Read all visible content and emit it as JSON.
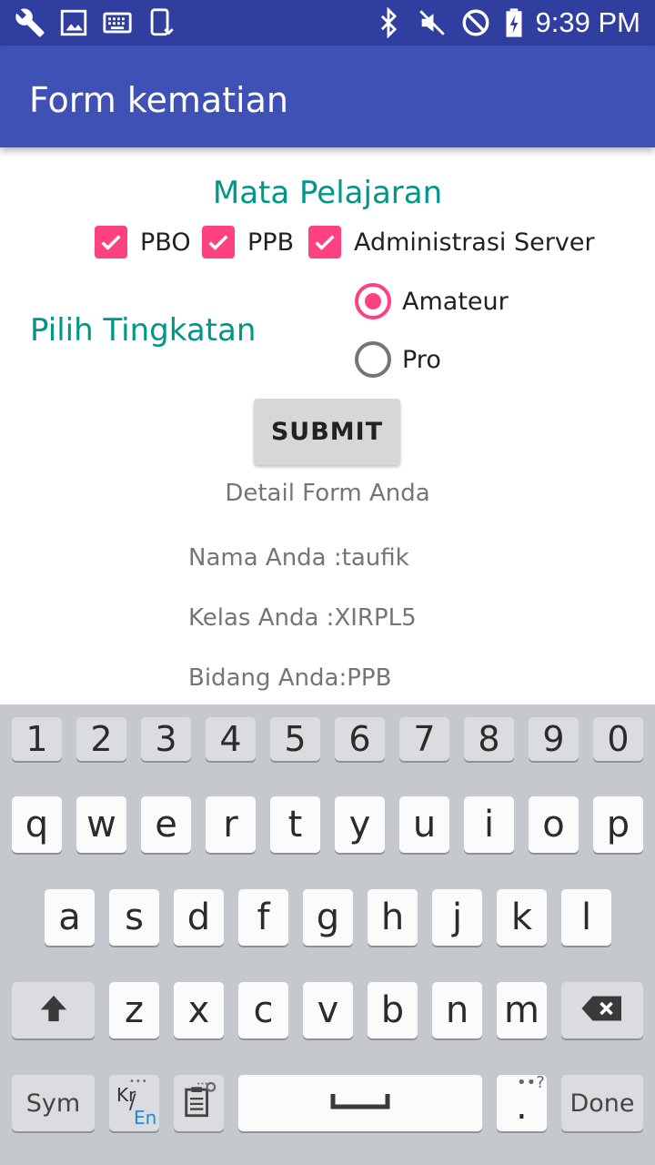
{
  "status_bar": {
    "time": "9:39 PM",
    "left_icons": [
      "wrench-icon",
      "image-icon",
      "keyboard-icon",
      "device-rotate-icon"
    ],
    "right_icons": [
      "bluetooth-icon",
      "mute-icon",
      "do-not-disturb-icon",
      "battery-charging-icon"
    ]
  },
  "app_bar": {
    "title": "Form kematian"
  },
  "subjects": {
    "title": "Mata Pelajaran",
    "options": [
      {
        "label": "PBO",
        "checked": true
      },
      {
        "label": "PPB",
        "checked": true
      },
      {
        "label": "Administrasi Server",
        "checked": true
      }
    ]
  },
  "level": {
    "label": "Pilih Tingkatan",
    "options": [
      {
        "label": "Amateur",
        "selected": true
      },
      {
        "label": "Pro",
        "selected": false
      }
    ]
  },
  "submit_label": "SUBMIT",
  "details": {
    "title": "Detail Form Anda",
    "name": "Nama Anda :taufik",
    "class": "Kelas Anda :XIRPL5",
    "field": "Bidang Anda:PPB"
  },
  "keyboard": {
    "number_row": [
      "1",
      "2",
      "3",
      "4",
      "5",
      "6",
      "7",
      "8",
      "9",
      "0"
    ],
    "row1": [
      "q",
      "w",
      "e",
      "r",
      "t",
      "y",
      "u",
      "i",
      "o",
      "p"
    ],
    "row2": [
      "a",
      "s",
      "d",
      "f",
      "g",
      "h",
      "j",
      "k",
      "l"
    ],
    "row3": [
      "z",
      "x",
      "c",
      "v",
      "b",
      "n",
      "m"
    ],
    "sym_label": "Sym",
    "lang_top": "Kr",
    "lang_bottom": "En",
    "done_label": "Done",
    "accent_color": "#1E88E5"
  },
  "colors": {
    "primary": "#3F51B5",
    "primary_dark": "#303F9F",
    "accent": "#FF4081",
    "teal": "#009688"
  }
}
